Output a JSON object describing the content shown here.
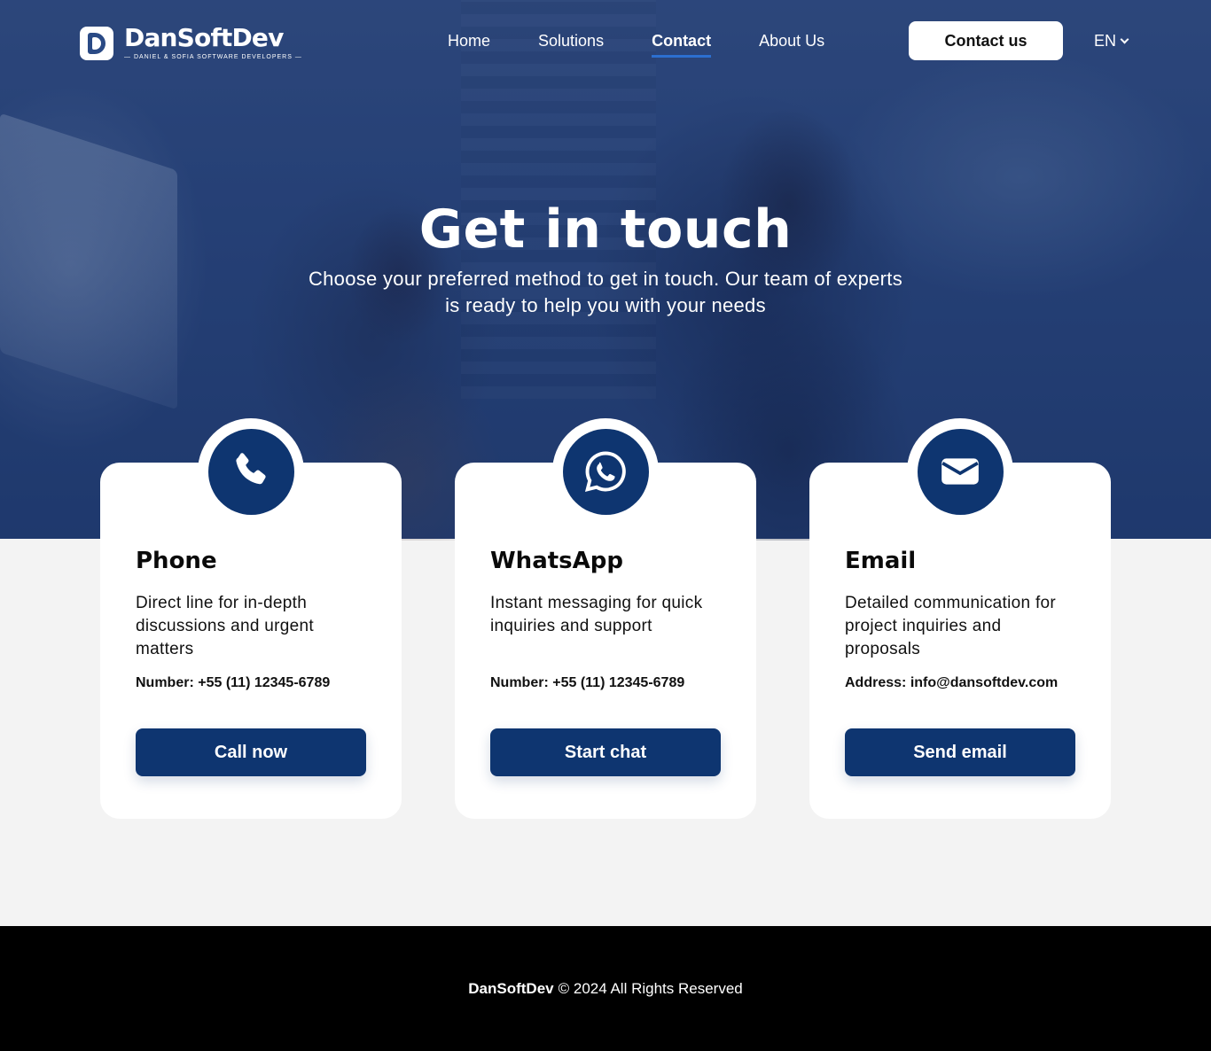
{
  "brand": {
    "name": "DanSoftDev",
    "tagline": "— DANIEL & SOFIA SOFTWARE DEVELOPERS —"
  },
  "nav": {
    "items": [
      {
        "label": "Home"
      },
      {
        "label": "Solutions"
      },
      {
        "label": "Contact",
        "active": true
      },
      {
        "label": "About Us"
      }
    ],
    "cta_label": "Contact us",
    "language": "EN"
  },
  "hero": {
    "title": "Get in touch",
    "subtitle": "Choose your preferred method to get in touch. Our team of experts is ready to help you with your needs"
  },
  "cards": [
    {
      "icon": "phone-icon",
      "title": "Phone",
      "description": "Direct line for in-depth discussions and urgent matters",
      "info_label": "Number:",
      "info_value": "+55 (11) 12345-6789",
      "button_label": "Call now"
    },
    {
      "icon": "whatsapp-icon",
      "title": "WhatsApp",
      "description": "Instant messaging for quick inquiries and support",
      "info_label": "Number:",
      "info_value": "+55 (11) 12345-6789",
      "button_label": "Start chat"
    },
    {
      "icon": "envelope-icon",
      "title": "Email",
      "description": "Detailed communication for project inquiries and proposals",
      "info_label": "Address:",
      "info_value": "info@dansoftdev.com",
      "button_label": "Send email"
    }
  ],
  "footer": {
    "brand": "DanSoftDev",
    "copyright": "© 2024 All Rights Reserved"
  },
  "colors": {
    "primary": "#0e3570",
    "accent_underline": "#2c6fd0",
    "page_background": "#f3f3f3",
    "footer_background": "#000000"
  }
}
